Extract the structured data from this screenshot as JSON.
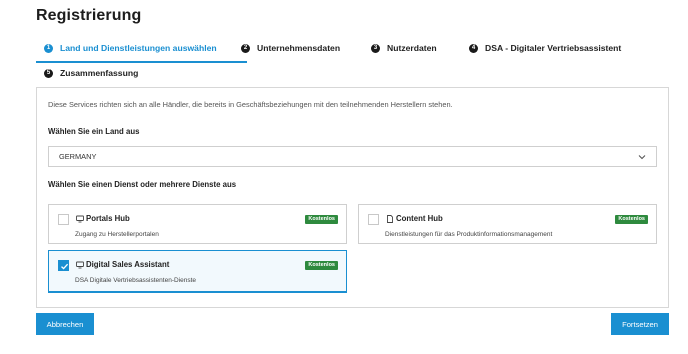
{
  "page": {
    "title": "Registrierung"
  },
  "steps": [
    {
      "number": "1",
      "label": "Land und Dienstleistungen auswählen",
      "active": true
    },
    {
      "number": "2",
      "label": "Unternehmensdaten",
      "active": false
    },
    {
      "number": "3",
      "label": "Nutzerdaten",
      "active": false
    },
    {
      "number": "4",
      "label": "DSA - Digitaler Vertriebsassistent",
      "active": false
    },
    {
      "number": "5",
      "label": "Zusammenfassung",
      "active": false
    }
  ],
  "form": {
    "intro": "Diese Services richten sich an alle Händler, die bereits in Geschäftsbeziehungen mit den teilnehmenden Herstellern stehen.",
    "country_label": "Wählen Sie ein Land aus",
    "country_value": "GERMANY",
    "service_label": "Wählen Sie einen Dienst oder mehrere Dienste aus"
  },
  "services": [
    {
      "name": "Portals Hub",
      "description": "Zugang zu Herstellerportalen",
      "badge": "Kostenlos",
      "selected": false,
      "icon": "screen-icon"
    },
    {
      "name": "Content Hub",
      "description": "Dienstleistungen für das Produktinformationsmanagement",
      "badge": "Kostenlos",
      "selected": false,
      "icon": "document-icon"
    },
    {
      "name": "Digital Sales Assistant",
      "description": "DSA Digitale Vertriebsassistenten-Dienste",
      "badge": "Kostenlos",
      "selected": true,
      "icon": "screen-icon"
    }
  ],
  "buttons": {
    "cancel": "Abbrechen",
    "next": "Fortsetzen"
  },
  "colors": {
    "accent": "#1a8fd1",
    "badge": "#2e8a3e"
  }
}
